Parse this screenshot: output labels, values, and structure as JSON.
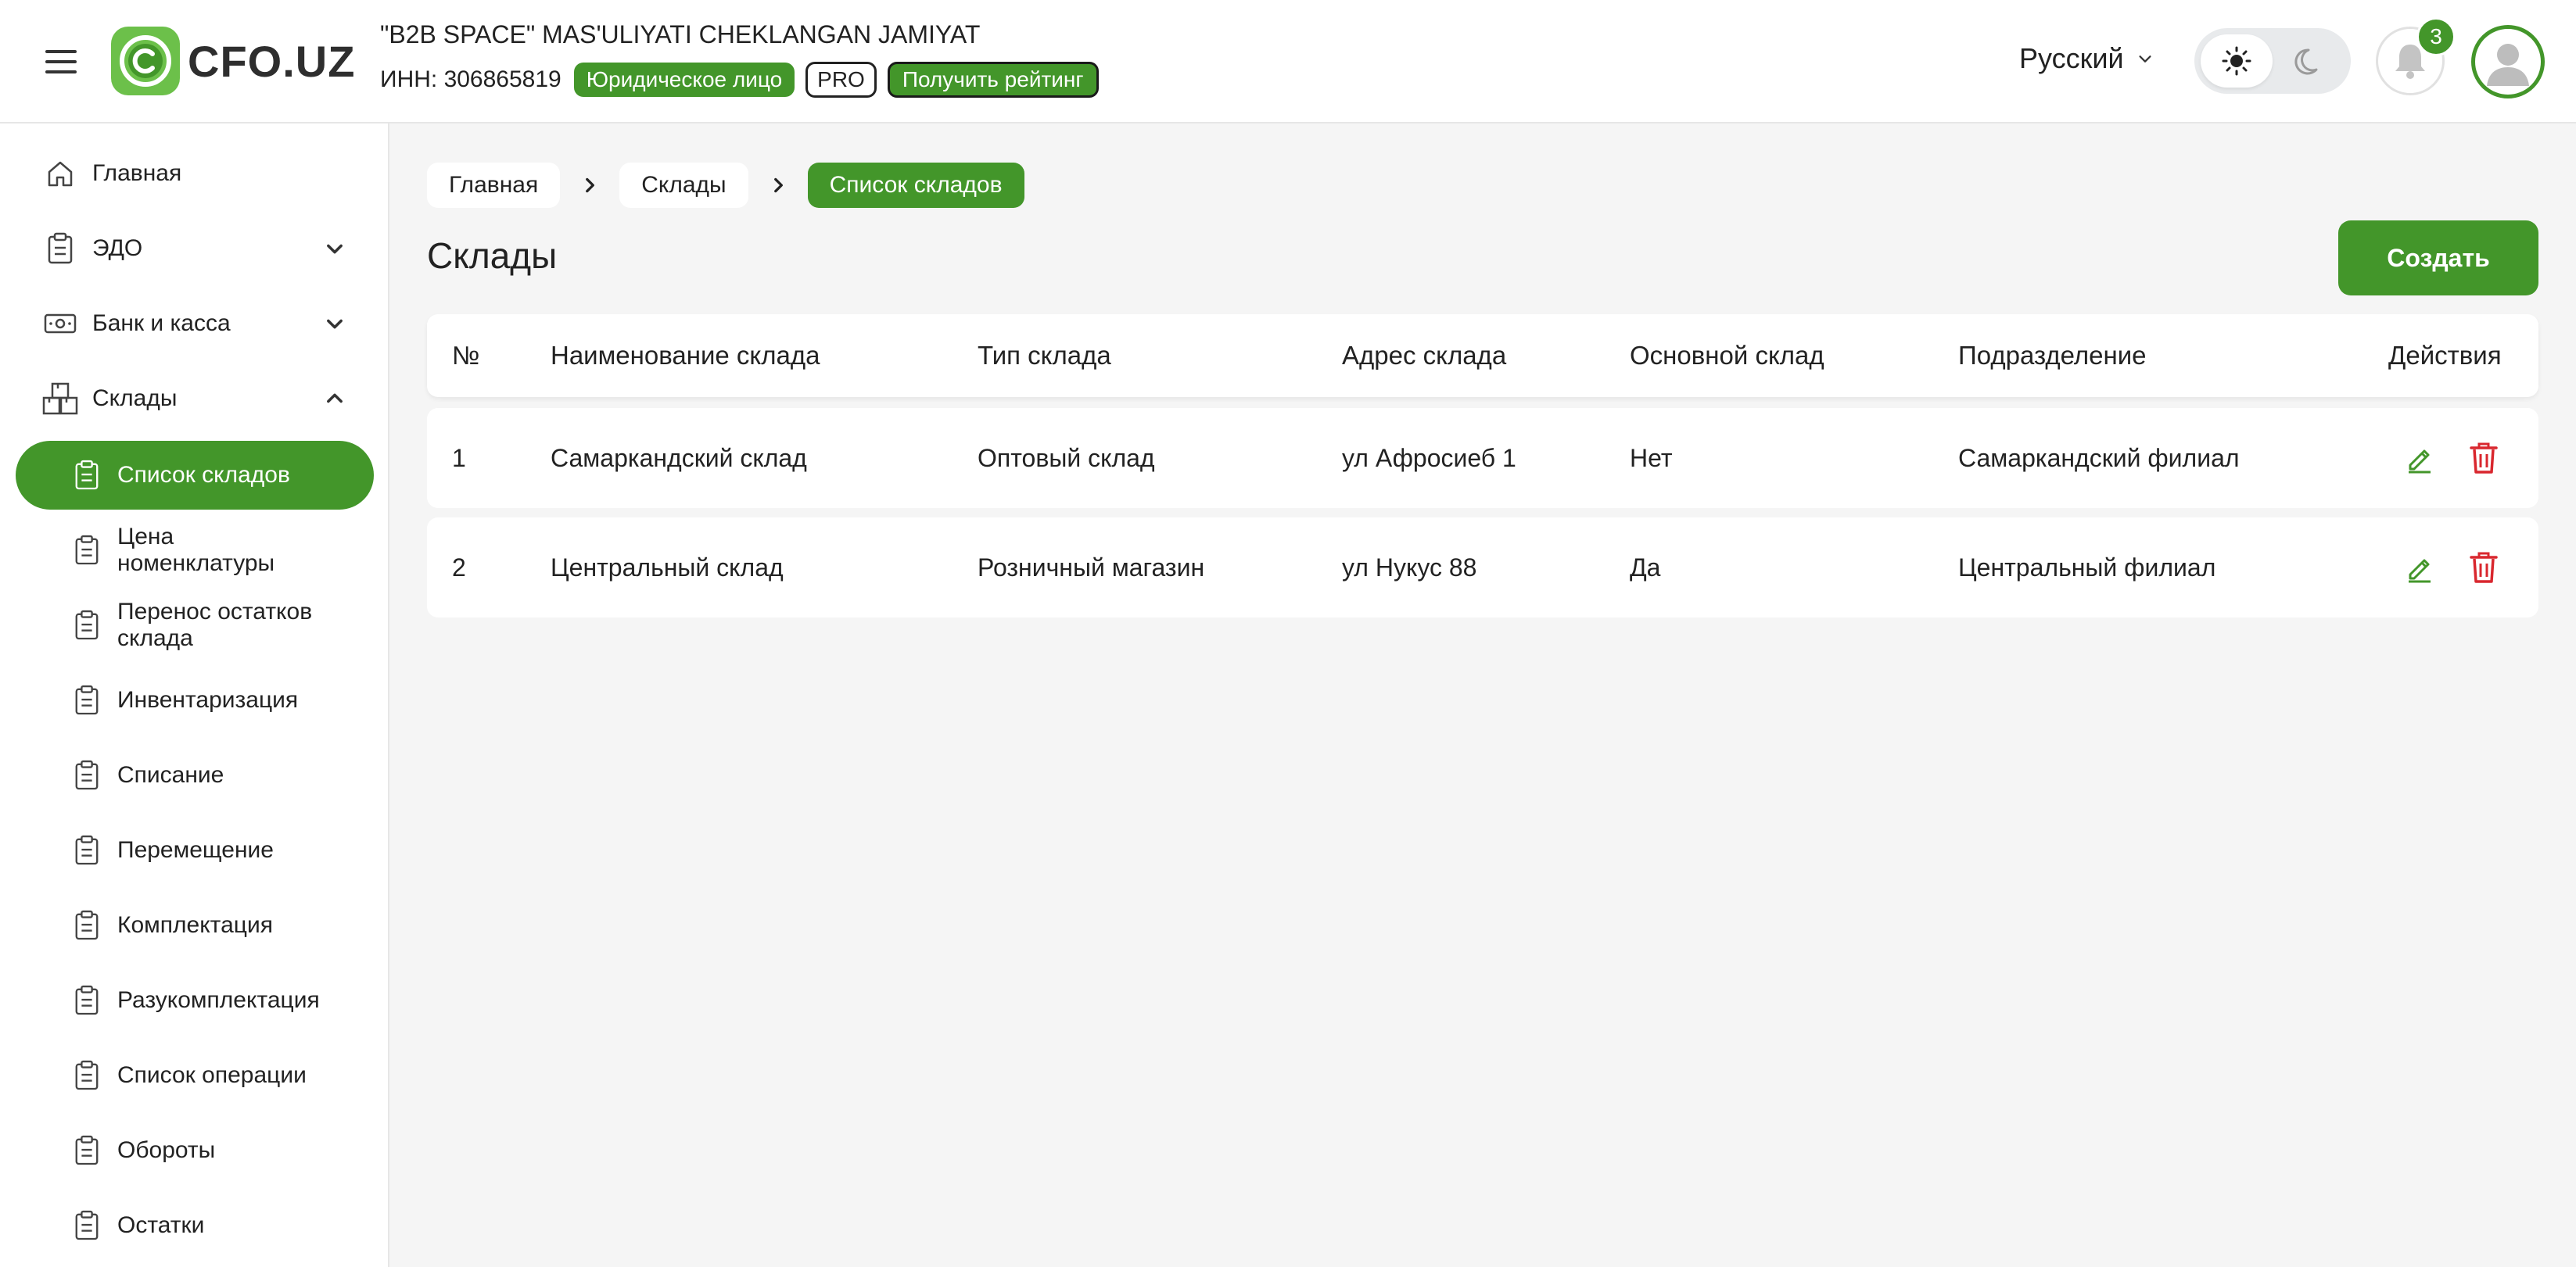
{
  "header": {
    "logo_text": "CFO.UZ",
    "company_name": "\"B2B SPACE\" MAS'ULIYATI CHEKLANGAN JAMIYAT",
    "inn": "ИНН: 306865819",
    "tag_entity": "Юридическое лицо",
    "tag_pro": "PRO",
    "rating_button": "Получить рейтинг",
    "language": "Русский",
    "notifications_count": "3",
    "icons": [
      "menu-icon",
      "sun-icon",
      "moon-icon",
      "bell-icon",
      "user-icon",
      "chevron-down-icon"
    ]
  },
  "sidebar": {
    "items": [
      {
        "label": "Главная",
        "icon": "home-icon"
      },
      {
        "label": "ЭДО",
        "icon": "clipboard-icon"
      },
      {
        "label": "Банк и касса",
        "icon": "cash-icon"
      },
      {
        "label": "Склады",
        "icon": "boxes-icon"
      }
    ],
    "sub_items": [
      {
        "label": "Список складов"
      },
      {
        "label": "Цена номенклатуры"
      },
      {
        "label": "Перенос остатков склада"
      },
      {
        "label": "Инвентаризация"
      },
      {
        "label": "Списание"
      },
      {
        "label": "Перемещение"
      },
      {
        "label": "Комплектация"
      },
      {
        "label": "Разукомплектация"
      },
      {
        "label": "Список операции"
      },
      {
        "label": "Обороты"
      },
      {
        "label": "Остатки"
      }
    ]
  },
  "breadcrumb": [
    "Главная",
    "Склады",
    "Список складов"
  ],
  "page": {
    "title": "Склады",
    "create_button": "Создать"
  },
  "table": {
    "columns": [
      "№",
      "Наименование склада",
      "Тип склада",
      "Адрес склада",
      "Основной склад",
      "Подразделение",
      "Действия"
    ],
    "rows": [
      [
        "1",
        "Самаркандский склад",
        "Оптовый склад",
        "ул Афросиеб 1",
        "Нет",
        "Самаркандский филиал"
      ],
      [
        "2",
        "Центральный склад",
        "Розничный магазин",
        "ул Нукус 88",
        "Да",
        "Центральный филиал"
      ]
    ]
  },
  "colors": {
    "accent": "#43962a",
    "danger": "#d9272e",
    "background": "#f5f5f5"
  }
}
